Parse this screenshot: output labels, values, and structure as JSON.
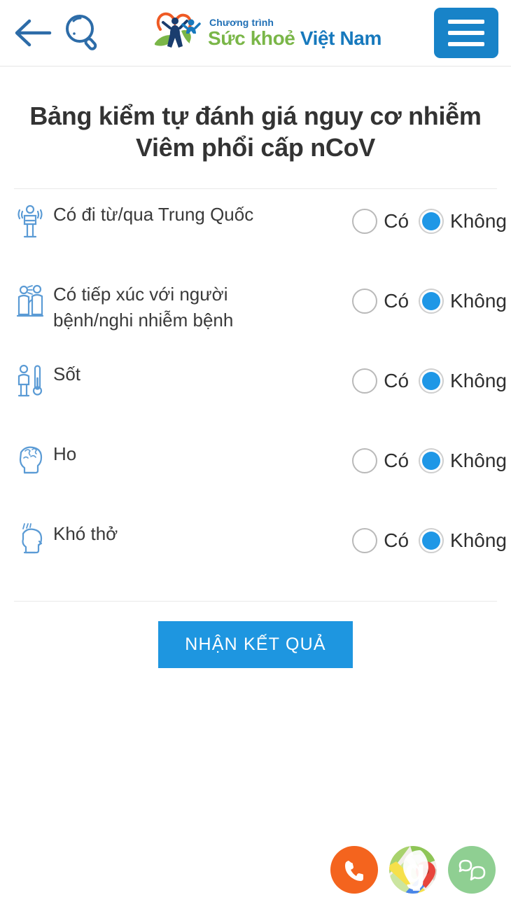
{
  "header": {
    "back_icon": "back-arrow-icon",
    "search_icon": "search-icon",
    "menu_icon": "hamburger-menu-icon",
    "logo": {
      "program_text": "Chương trình",
      "name_part1": "Sức khoẻ",
      "name_part2": "Việt Nam",
      "green": "#7ab648",
      "blue": "#1779bd"
    }
  },
  "page_title": "Bảng kiểm tự đánh giá nguy cơ nhiễm Viêm phổi cấp nCoV",
  "options": {
    "yes": "Có",
    "no": "Không"
  },
  "questions": [
    {
      "label": "Có đi từ/qua Trung Quốc",
      "icon": "traveler-person-icon",
      "selected": "no"
    },
    {
      "label": "Có tiếp xúc với người bệnh/nghi nhiễm bệnh",
      "icon": "two-people-contact-icon",
      "selected": "no"
    },
    {
      "label": "Sốt",
      "icon": "thermometer-fever-icon",
      "selected": "no"
    },
    {
      "label": "Ho",
      "icon": "head-cough-icon",
      "selected": "no"
    },
    {
      "label": "Khó thở",
      "icon": "head-breathing-icon",
      "selected": "no"
    }
  ],
  "submit": {
    "label": "NHẬN KẾT QUẢ",
    "color": "#1e96e0"
  },
  "floating_actions": [
    {
      "name": "phone-call-button",
      "icon": "phone-icon",
      "color": "#f4641e"
    },
    {
      "name": "map-directions-button",
      "icon": "google-maps-icon",
      "color": "#ffffff"
    },
    {
      "name": "chat-button",
      "icon": "chat-bubbles-icon",
      "color": "#8fcf92"
    }
  ],
  "accent_color": "#1883c8"
}
